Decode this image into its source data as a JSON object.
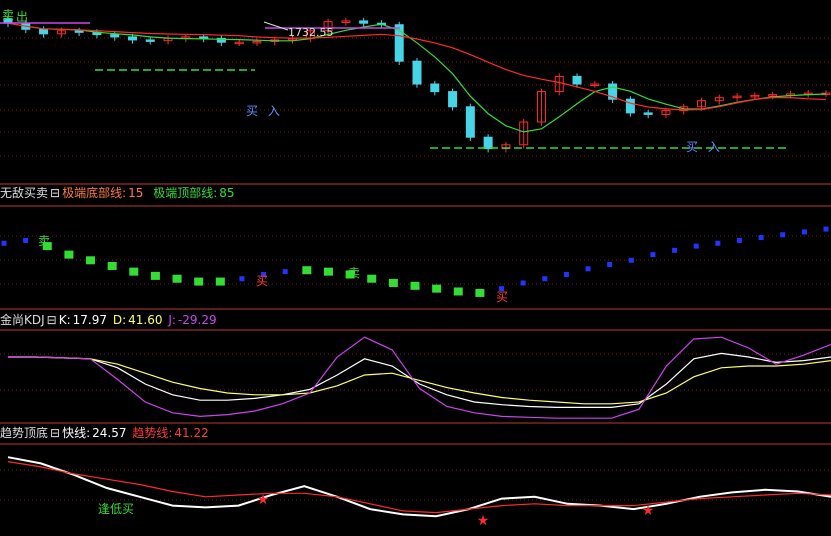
{
  "colors": {
    "bg": "#000000",
    "panel_border": "#c0392b",
    "grid": "#7a1a1a",
    "up": "#ff2a2a",
    "down": "#46d4e6",
    "green": "#33dd33",
    "blue": "#2233ff",
    "white": "#ffffff",
    "yellow": "#ffff66",
    "magenta": "#cc44ee",
    "label_blue": "#5f8fff"
  },
  "panel1": {
    "top_label_a": "卖",
    "top_label_b": "出",
    "price_label": "1732.55",
    "buy_label_1": "买  入",
    "buy_label_2": "买  入"
  },
  "panel2": {
    "name": "无敌买卖",
    "param_a_label": "极端底部线:",
    "param_a_value": "15",
    "param_b_label": "极端顶部线:",
    "param_b_value": "85",
    "sell_label": "卖",
    "buy_label": "买"
  },
  "panel3": {
    "name": "金尚KDJ",
    "k_label": "K:",
    "k_value": "17.97",
    "d_label": "D:",
    "d_value": "41.60",
    "j_label": "J:",
    "j_value": "-29.29"
  },
  "panel4": {
    "name": "趋势顶底",
    "fast_label": "快线:",
    "fast_value": "24.57",
    "trend_label": "趋势线:",
    "trend_value": "41.22",
    "note_label": "逢低买"
  },
  "chart_data": [
    {
      "type": "candlestick",
      "title": "",
      "series": [
        {
          "name": "close",
          "values": [
            1770,
            1762,
            1756,
            1760,
            1758,
            1755,
            1752,
            1748,
            1747,
            1750,
            1752,
            1750,
            1745,
            1745,
            1746,
            1748,
            1750,
            1760,
            1772,
            1773,
            1770,
            1768,
            1720,
            1690,
            1680,
            1660,
            1620,
            1605,
            1610,
            1640,
            1680,
            1700,
            1690,
            1690,
            1670,
            1652,
            1650,
            1655,
            1660,
            1668,
            1672,
            1674,
            1675,
            1676,
            1677,
            1678,
            1678
          ]
        }
      ]
    },
    {
      "type": "bar",
      "title": "无敌买卖",
      "series": [
        {
          "name": "signal",
          "values": [
            60,
            62,
            58,
            52,
            48,
            44,
            40,
            37,
            35,
            33,
            33,
            35,
            38,
            40,
            41,
            40,
            38,
            35,
            32,
            30,
            28,
            26,
            25,
            28,
            32,
            35,
            38,
            42,
            45,
            48,
            52,
            55,
            58,
            60,
            62,
            64,
            66,
            68,
            70
          ]
        }
      ]
    },
    {
      "type": "line",
      "title": "金尚KDJ",
      "series": [
        {
          "name": "K",
          "values": [
            70,
            70,
            69,
            68,
            58,
            40,
            28,
            22,
            22,
            24,
            28,
            34,
            50,
            68,
            60,
            40,
            28,
            20,
            17,
            15,
            14,
            14,
            14,
            18,
            40,
            68,
            74,
            70,
            64,
            66,
            70
          ]
        },
        {
          "name": "D",
          "values": [
            70,
            70,
            69,
            68,
            62,
            52,
            42,
            35,
            30,
            28,
            28,
            30,
            38,
            50,
            52,
            44,
            36,
            30,
            25,
            22,
            20,
            18,
            18,
            20,
            30,
            48,
            58,
            60,
            60,
            62,
            66
          ]
        },
        {
          "name": "J",
          "values": [
            70,
            70,
            69,
            68,
            45,
            20,
            8,
            4,
            6,
            10,
            18,
            30,
            70,
            92,
            78,
            35,
            15,
            8,
            4,
            3,
            2,
            2,
            2,
            12,
            60,
            90,
            92,
            80,
            62,
            72,
            84
          ]
        }
      ]
    },
    {
      "type": "line",
      "title": "趋势顶底",
      "series": [
        {
          "name": "快线",
          "values": [
            85,
            78,
            65,
            50,
            40,
            30,
            28,
            30,
            42,
            52,
            40,
            26,
            20,
            18,
            26,
            38,
            40,
            32,
            30,
            26,
            32,
            40,
            45,
            48,
            46,
            40
          ]
        },
        {
          "name": "趋势线",
          "values": [
            80,
            74,
            66,
            60,
            54,
            46,
            40,
            42,
            44,
            44,
            40,
            32,
            24,
            22,
            26,
            30,
            32,
            30,
            30,
            30,
            34,
            38,
            40,
            42,
            44,
            42
          ]
        }
      ]
    }
  ]
}
